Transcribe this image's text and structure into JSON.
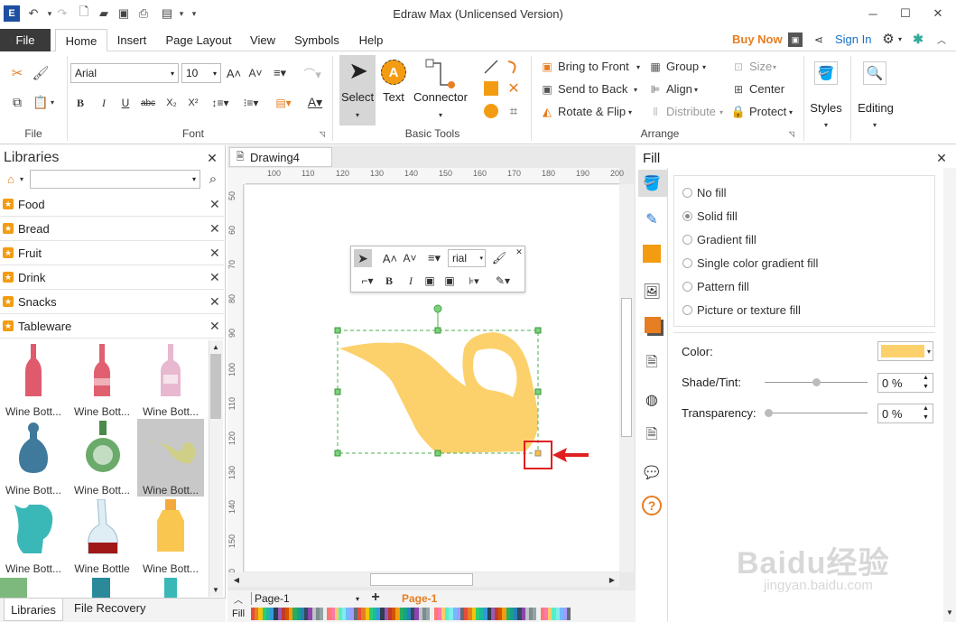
{
  "app": {
    "title": "Edraw Max (Unlicensed Version)"
  },
  "menu": {
    "file": "File",
    "tabs": [
      "Home",
      "Insert",
      "Page Layout",
      "View",
      "Symbols",
      "Help"
    ],
    "buy_now": "Buy Now",
    "sign_in": "Sign In"
  },
  "ribbon": {
    "file_group": "File",
    "font_group": "Font",
    "font_name": "Arial",
    "font_size": "10",
    "basic_tools_group": "Basic Tools",
    "select_label": "Select",
    "text_label": "Text",
    "connector_label": "Connector",
    "arrange_group": "Arrange",
    "bring_to_front": "Bring to Front",
    "send_to_back": "Send to Back",
    "rotate_flip": "Rotate & Flip",
    "group": "Group",
    "align": "Align",
    "distribute": "Distribute",
    "size": "Size",
    "center": "Center",
    "protect": "Protect",
    "styles": "Styles",
    "editing": "Editing",
    "text_icon_letter": "A"
  },
  "libraries": {
    "title": "Libraries",
    "categories": [
      "Food",
      "Bread",
      "Fruit",
      "Drink",
      "Snacks",
      "Tableware"
    ],
    "items": [
      {
        "caption": "Wine Bott...",
        "color": "#e05a6e"
      },
      {
        "caption": "Wine Bott...",
        "color": "#e06070"
      },
      {
        "caption": "Wine Bott...",
        "color": "#e8b8d0"
      },
      {
        "caption": "Wine Bott...",
        "color": "#3f7a9c"
      },
      {
        "caption": "Wine Bott...",
        "color": "#6aaa6a"
      },
      {
        "caption": "Wine Bott...",
        "color": "#cfcf88"
      },
      {
        "caption": "Wine Bott...",
        "color": "#3ab8b8"
      },
      {
        "caption": "Wine Bottle",
        "color": "#a01818"
      },
      {
        "caption": "Wine Bott...",
        "color": "#f9c74f"
      }
    ],
    "bottom_tabs": [
      "Libraries",
      "File Recovery"
    ]
  },
  "canvas": {
    "doc_tab": "Drawing4",
    "ruler_h": [
      "100",
      "110",
      "120",
      "130",
      "140",
      "150",
      "160",
      "170",
      "180",
      "190",
      "200"
    ],
    "ruler_v": [
      "50",
      "60",
      "70",
      "80",
      "90",
      "100",
      "110",
      "120",
      "130",
      "140",
      "150",
      "160"
    ],
    "mini_toolbar_font": "rial",
    "shape_color": "#fcd16b",
    "page_selector": "Page-1",
    "active_page": "Page-1",
    "fill_label": "Fill"
  },
  "fill_panel": {
    "title": "Fill",
    "options": [
      "No fill",
      "Solid fill",
      "Gradient fill",
      "Single color gradient fill",
      "Pattern fill",
      "Picture or texture fill"
    ],
    "selected": "Solid fill",
    "color_label": "Color:",
    "color_value": "#fcd16b",
    "shade_label": "Shade/Tint:",
    "shade_value": "0 %",
    "transparency_label": "Transparency:",
    "transparency_value": "0 %",
    "shade_level": 0.5,
    "transparency_level": 0
  },
  "watermark": {
    "brand": "Baidu经验",
    "url": "jingyan.baidu.com"
  },
  "colors": {
    "accent": "#e67e22",
    "annotation": "#e02020",
    "file_tab": "#3a3a3a",
    "sign_in": "#1a6fc4"
  }
}
